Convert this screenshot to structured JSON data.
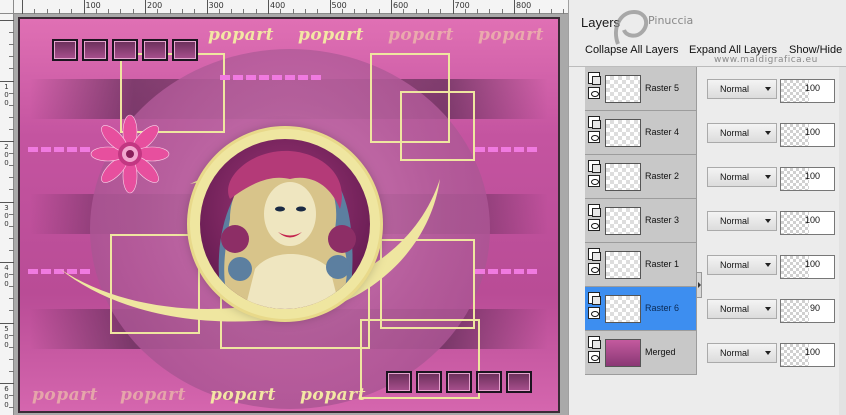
{
  "panel": {
    "title": "Layers",
    "toolbar": {
      "collapse": "Collapse All Layers",
      "expand": "Expand All Layers",
      "show_hide": "Show/Hide"
    }
  },
  "watermark": {
    "name": "Pinuccia",
    "site": "www.maldigrafica.eu"
  },
  "layers": [
    {
      "name": "Raster 5",
      "blend": "Normal",
      "opacity": "100",
      "selected": false
    },
    {
      "name": "Raster 4",
      "blend": "Normal",
      "opacity": "100",
      "selected": false
    },
    {
      "name": "Raster 2",
      "blend": "Normal",
      "opacity": "100",
      "selected": false
    },
    {
      "name": "Raster 3",
      "blend": "Normal",
      "opacity": "100",
      "selected": false
    },
    {
      "name": "Raster 1",
      "blend": "Normal",
      "opacity": "100",
      "selected": false
    },
    {
      "name": "Raster 6",
      "blend": "Normal",
      "opacity": "90",
      "selected": true
    },
    {
      "name": "Merged",
      "blend": "Normal",
      "opacity": "100",
      "selected": false
    }
  ],
  "canvas": {
    "word": "popart",
    "rulers": {
      "top": [
        "100",
        "200",
        "300",
        "400",
        "500",
        "600",
        "700",
        "800"
      ],
      "left": [
        "100",
        "200",
        "300",
        "400",
        "500",
        "600"
      ]
    }
  },
  "colors": {
    "selected_layer": "#3d8ef0",
    "canvas_pink": "#c454a0",
    "frame_yellow": "#efe6a0"
  }
}
